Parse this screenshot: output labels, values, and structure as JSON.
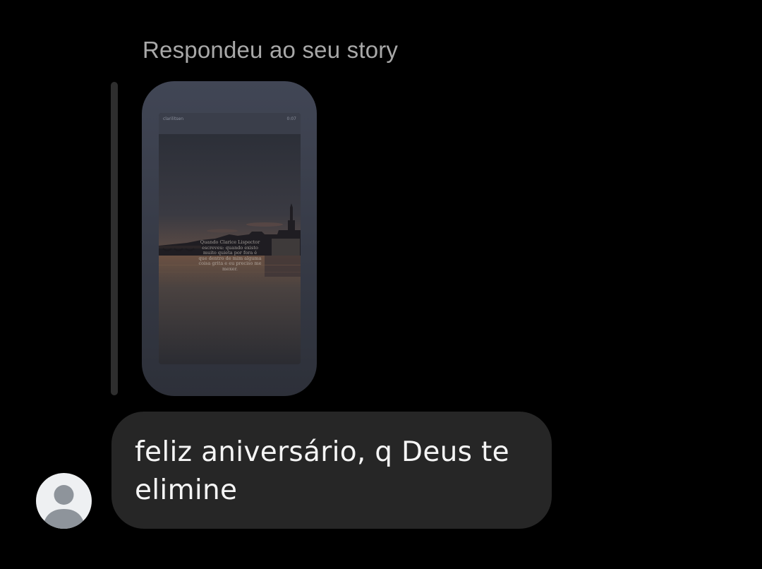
{
  "reply": {
    "caption": "Respondeu ao seu story"
  },
  "story": {
    "username": "clarilitsen",
    "time": "0:07",
    "quote_text": "Quando Clarice Lispector escreveu: quando existo muito quieta por fora é que dentro de mim alguma coisa grita e eu preciso me mexer."
  },
  "message": {
    "text": "feliz aniversário, q Deus te elimine"
  },
  "sender": {
    "avatar_icon": "default-user-icon"
  },
  "colors": {
    "background": "#000000",
    "bubble": "#262626",
    "caption": "#a8a8a8",
    "message_text": "#f5f5f5"
  }
}
